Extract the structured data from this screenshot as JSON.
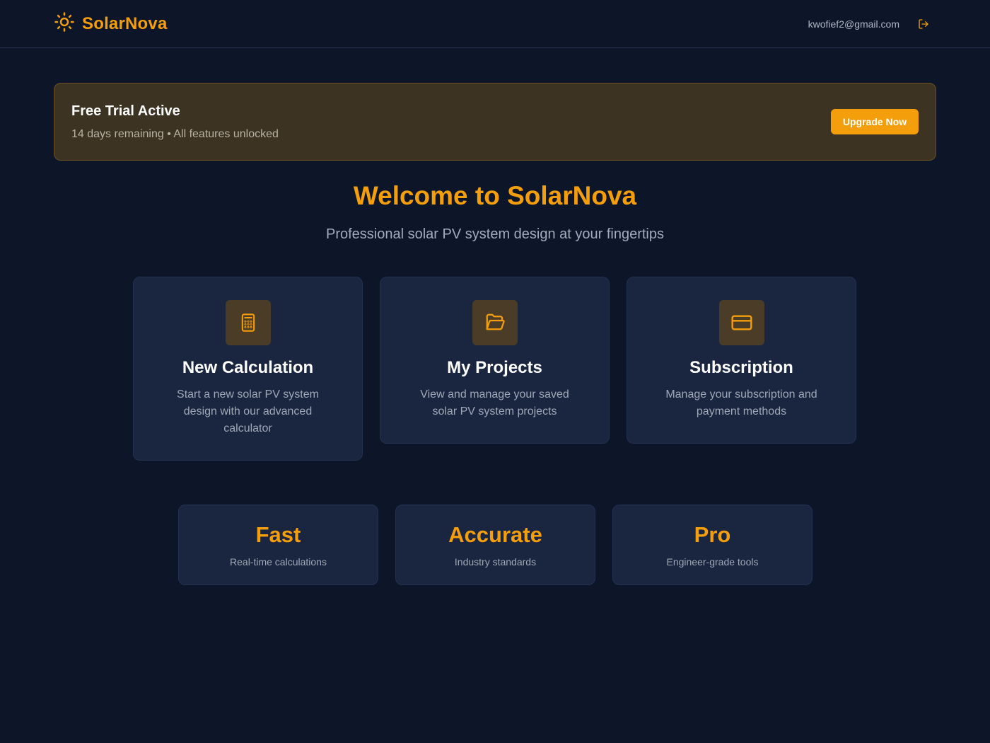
{
  "header": {
    "brand": "SolarNova",
    "user_email": "kwofief2@gmail.com"
  },
  "trial": {
    "title": "Free Trial Active",
    "subtitle": "14 days remaining • All features unlocked",
    "button": "Upgrade Now"
  },
  "welcome": {
    "title": "Welcome to SolarNova",
    "subtitle": "Professional solar PV system design at your fingertips"
  },
  "cards": [
    {
      "icon": "calculator-icon",
      "title": "New Calculation",
      "desc": "Start a new solar PV system design with our advanced calculator"
    },
    {
      "icon": "folder-open-icon",
      "title": "My Projects",
      "desc": "View and manage your saved solar PV system projects"
    },
    {
      "icon": "credit-card-icon",
      "title": "Subscription",
      "desc": "Manage your subscription and payment methods"
    }
  ],
  "stats": [
    {
      "title": "Fast",
      "sub": "Real-time calculations"
    },
    {
      "title": "Accurate",
      "sub": "Industry standards"
    },
    {
      "title": "Pro",
      "sub": "Engineer-grade tools"
    }
  ],
  "colors": {
    "accent": "#f59e0b",
    "background": "#0d1628",
    "card": "#1a2540"
  }
}
